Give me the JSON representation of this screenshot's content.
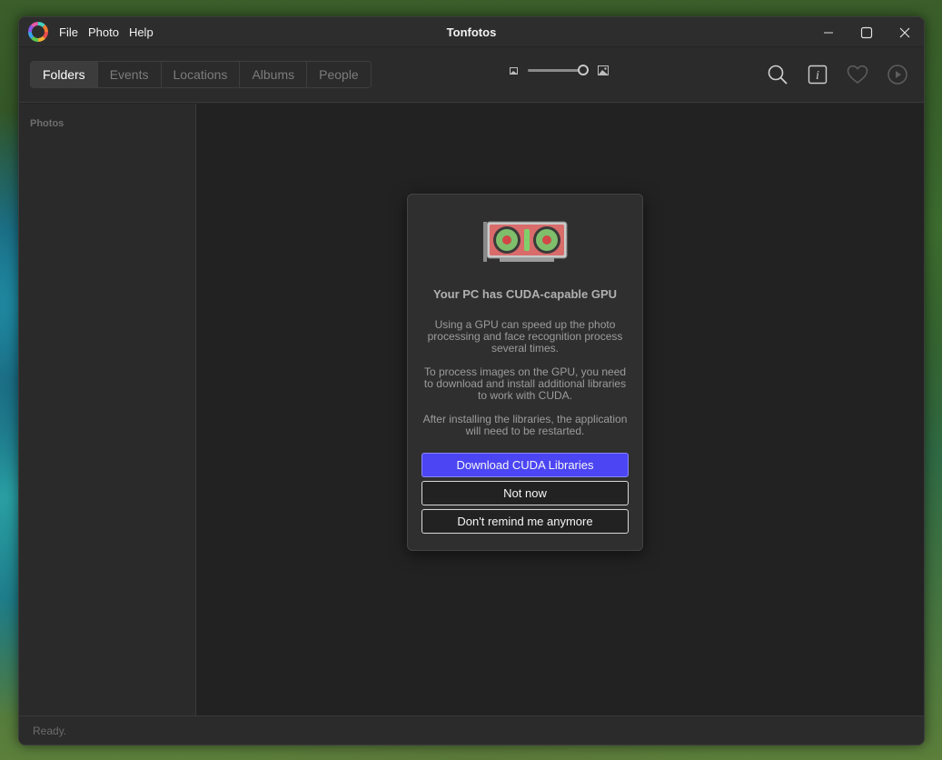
{
  "window": {
    "title": "Tonfotos",
    "menu": [
      "File",
      "Photo",
      "Help"
    ]
  },
  "toolbar": {
    "tabs": [
      "Folders",
      "Events",
      "Locations",
      "Albums",
      "People"
    ],
    "active_tab": "Folders",
    "zoom_level": 0.92
  },
  "sidebar": {
    "heading": "Photos"
  },
  "dialog": {
    "title": "Your PC has CUDA-capable GPU",
    "paragraph1": "Using a GPU can speed up the photo processing and face recognition process several times.",
    "paragraph2": "To process images on the GPU, you need to download and install additional libraries to work with CUDA.",
    "paragraph3": "After installing the libraries, the application will need to be restarted.",
    "primary_button": "Download CUDA Libraries",
    "secondary_button": "Not now",
    "tertiary_button": "Don't remind me anymore"
  },
  "statusbar": {
    "text": "Ready."
  },
  "colors": {
    "accent": "#4b45f3",
    "window_bg": "#252526",
    "dialog_bg": "#2f2f2f"
  }
}
